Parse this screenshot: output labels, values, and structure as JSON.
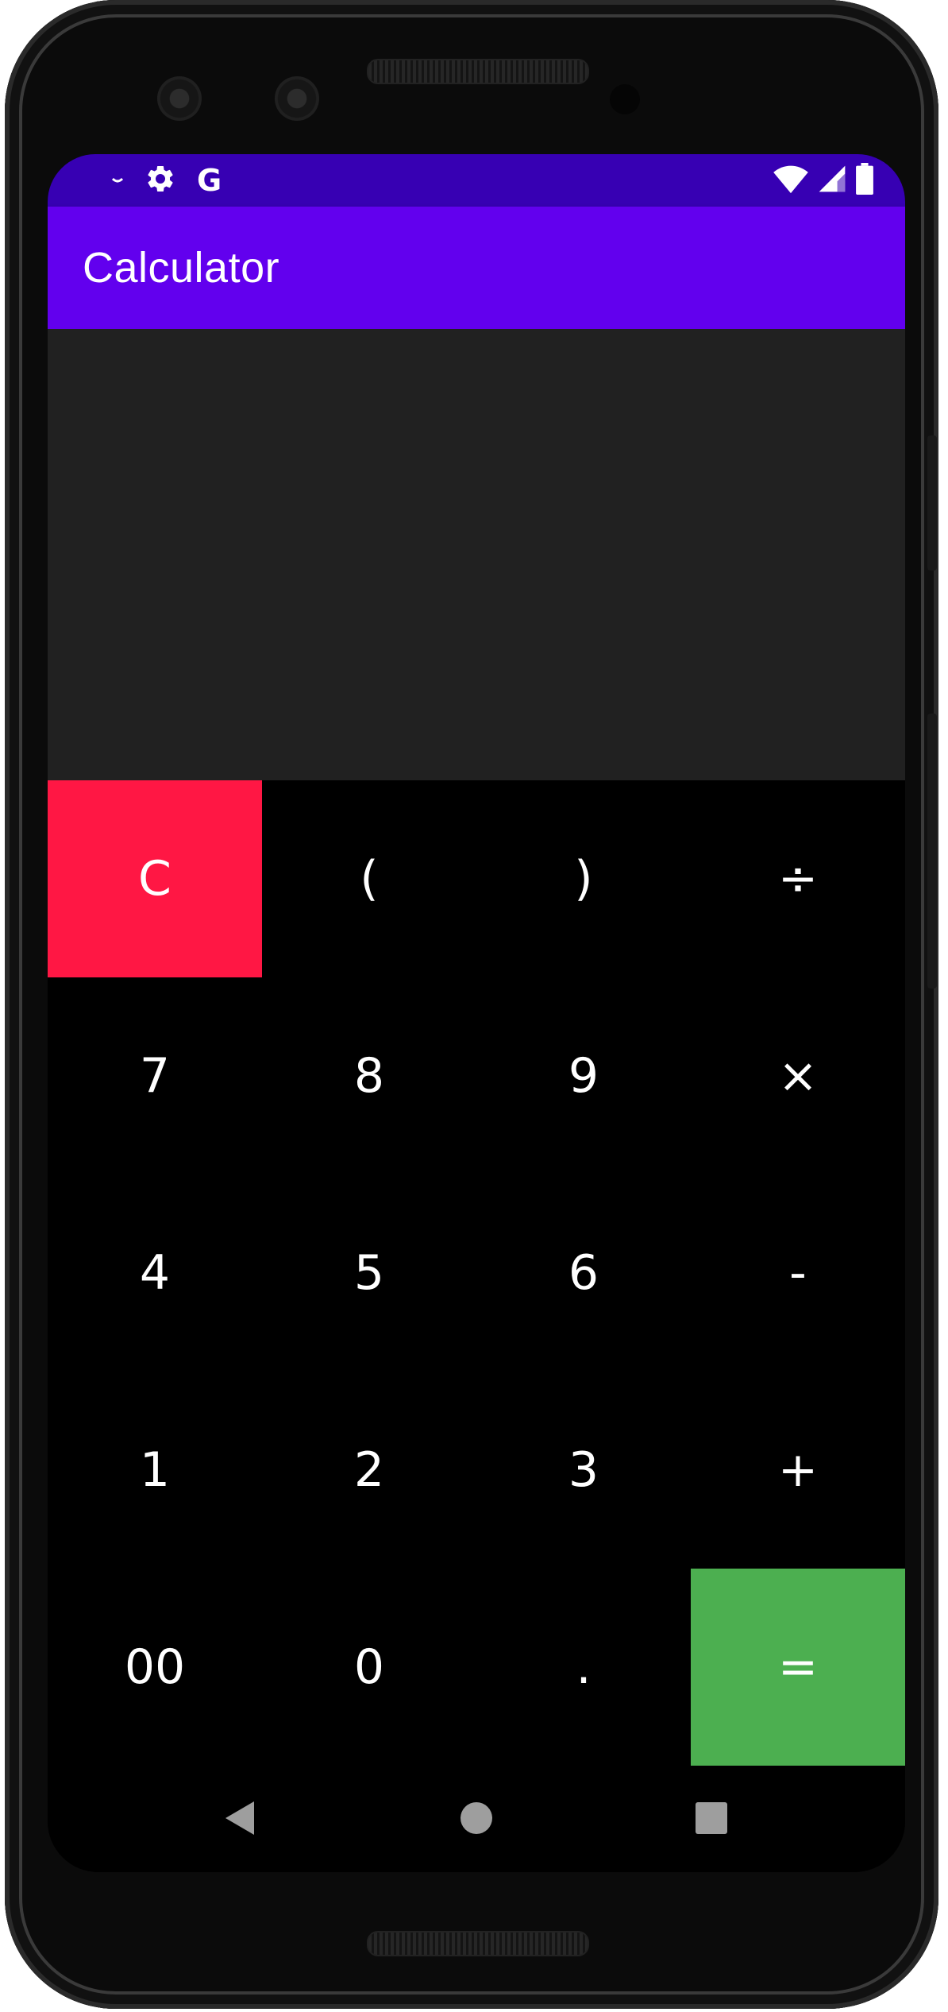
{
  "status_bar": {
    "left_icons": [
      "notification-dot-icon",
      "settings-gear-icon",
      "google-g-icon"
    ],
    "google_letter": "G",
    "right_icons": [
      "wifi-icon",
      "cellular-signal-icon",
      "battery-icon"
    ]
  },
  "app_bar": {
    "title": "Calculator"
  },
  "display": {
    "value": ""
  },
  "keypad": {
    "rows": [
      [
        "C",
        "(",
        ")",
        "÷"
      ],
      [
        "7",
        "8",
        "9",
        "×"
      ],
      [
        "4",
        "5",
        "6",
        "-"
      ],
      [
        "1",
        "2",
        "3",
        "+"
      ],
      [
        "00",
        "0",
        ".",
        "="
      ]
    ],
    "colors": {
      "clear": "#ff1744",
      "equals": "#4caf50",
      "key_background": "#000000",
      "display_background": "#212121",
      "app_bar": "#6200ee",
      "status_bar": "#3700b3"
    }
  },
  "nav_bar": {
    "buttons": [
      "back-triangle-icon",
      "home-circle-icon",
      "recents-square-icon"
    ]
  }
}
